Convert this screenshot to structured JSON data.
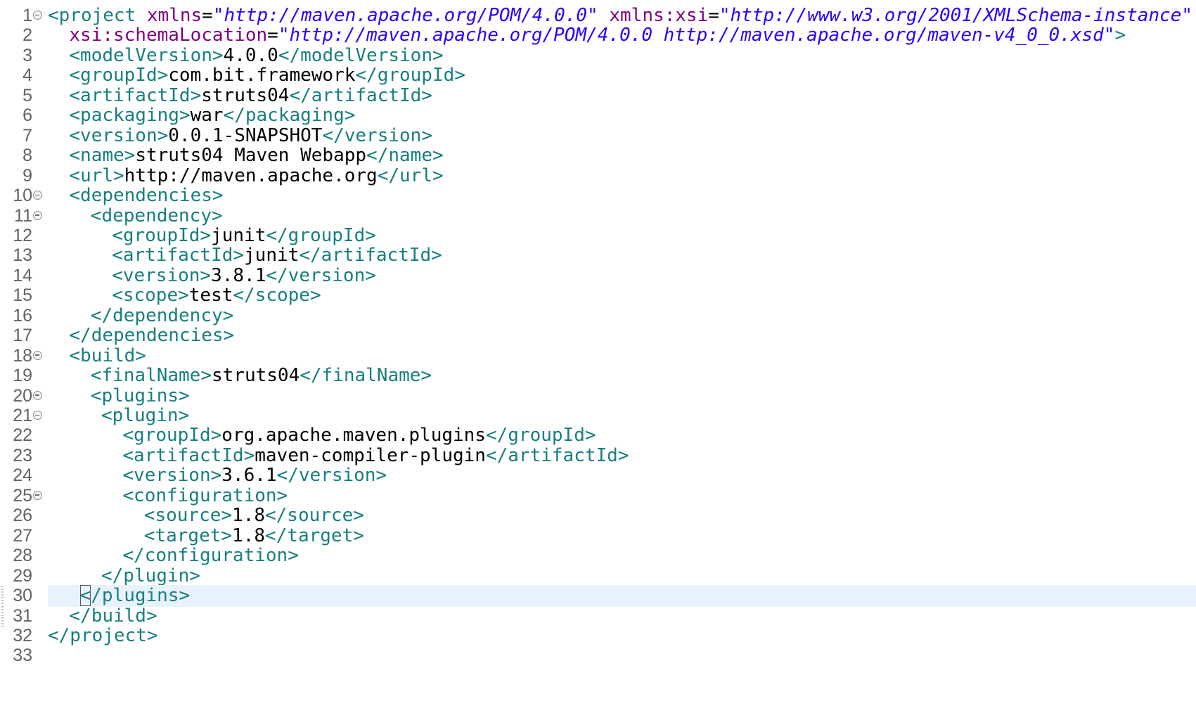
{
  "editor": {
    "current_line": 30,
    "colors": {
      "tag": "#177f80",
      "attribute": "#7f007f",
      "string": "#2a00ff",
      "text": "#000000",
      "line_highlight": "#e8f2fe",
      "line_number": "#5f6368"
    },
    "lines": [
      {
        "n": "1",
        "fold": true,
        "indent": 0,
        "tokens": [
          {
            "t": "tag",
            "v": "<project "
          },
          {
            "t": "attr",
            "v": "xmlns"
          },
          {
            "t": "txt",
            "v": "="
          },
          {
            "t": "str",
            "v": "\"http://maven.apache.org/POM/4.0.0\""
          },
          {
            "t": "txt",
            "v": " "
          },
          {
            "t": "attr",
            "v": "xmlns:xsi"
          },
          {
            "t": "txt",
            "v": "="
          },
          {
            "t": "str",
            "v": "\"http://www.w3.org/2001/XMLSchema-instance\""
          }
        ]
      },
      {
        "n": "2",
        "indent": 2,
        "tokens": [
          {
            "t": "attr",
            "v": "xsi:schemaLocation"
          },
          {
            "t": "txt",
            "v": "="
          },
          {
            "t": "str",
            "v": "\"http://maven.apache.org/POM/4.0.0 http://maven.apache.org/maven-v4_0_0.xsd\""
          },
          {
            "t": "tag",
            "v": ">"
          }
        ]
      },
      {
        "n": "3",
        "indent": 2,
        "tokens": [
          {
            "t": "tag",
            "v": "<modelVersion>"
          },
          {
            "t": "txt",
            "v": "4.0.0"
          },
          {
            "t": "tag",
            "v": "</modelVersion>"
          }
        ]
      },
      {
        "n": "4",
        "indent": 2,
        "tokens": [
          {
            "t": "tag",
            "v": "<groupId>"
          },
          {
            "t": "txt",
            "v": "com.bit.framework"
          },
          {
            "t": "tag",
            "v": "</groupId>"
          }
        ]
      },
      {
        "n": "5",
        "indent": 2,
        "tokens": [
          {
            "t": "tag",
            "v": "<artifactId>"
          },
          {
            "t": "txt",
            "v": "struts04"
          },
          {
            "t": "tag",
            "v": "</artifactId>"
          }
        ]
      },
      {
        "n": "6",
        "indent": 2,
        "tokens": [
          {
            "t": "tag",
            "v": "<packaging>"
          },
          {
            "t": "txt",
            "v": "war"
          },
          {
            "t": "tag",
            "v": "</packaging>"
          }
        ]
      },
      {
        "n": "7",
        "indent": 2,
        "tokens": [
          {
            "t": "tag",
            "v": "<version>"
          },
          {
            "t": "txt",
            "v": "0.0.1-SNAPSHOT"
          },
          {
            "t": "tag",
            "v": "</version>"
          }
        ]
      },
      {
        "n": "8",
        "indent": 2,
        "tokens": [
          {
            "t": "tag",
            "v": "<name>"
          },
          {
            "t": "txt",
            "v": "struts04 Maven Webapp"
          },
          {
            "t": "tag",
            "v": "</name>"
          }
        ]
      },
      {
        "n": "9",
        "indent": 2,
        "tokens": [
          {
            "t": "tag",
            "v": "<url>"
          },
          {
            "t": "txt",
            "v": "http://maven.apache.org"
          },
          {
            "t": "tag",
            "v": "</url>"
          }
        ]
      },
      {
        "n": "10",
        "fold": true,
        "indent": 2,
        "tokens": [
          {
            "t": "tag",
            "v": "<dependencies>"
          }
        ]
      },
      {
        "n": "11",
        "fold": true,
        "indent": 4,
        "tokens": [
          {
            "t": "tag",
            "v": "<dependency>"
          }
        ]
      },
      {
        "n": "12",
        "indent": 6,
        "tokens": [
          {
            "t": "tag",
            "v": "<groupId>"
          },
          {
            "t": "txt",
            "v": "junit"
          },
          {
            "t": "tag",
            "v": "</groupId>"
          }
        ]
      },
      {
        "n": "13",
        "indent": 6,
        "tokens": [
          {
            "t": "tag",
            "v": "<artifactId>"
          },
          {
            "t": "txt",
            "v": "junit"
          },
          {
            "t": "tag",
            "v": "</artifactId>"
          }
        ]
      },
      {
        "n": "14",
        "indent": 6,
        "tokens": [
          {
            "t": "tag",
            "v": "<version>"
          },
          {
            "t": "txt",
            "v": "3.8.1"
          },
          {
            "t": "tag",
            "v": "</version>"
          }
        ]
      },
      {
        "n": "15",
        "indent": 6,
        "tokens": [
          {
            "t": "tag",
            "v": "<scope>"
          },
          {
            "t": "txt",
            "v": "test"
          },
          {
            "t": "tag",
            "v": "</scope>"
          }
        ]
      },
      {
        "n": "16",
        "indent": 4,
        "tokens": [
          {
            "t": "tag",
            "v": "</dependency>"
          }
        ]
      },
      {
        "n": "17",
        "indent": 2,
        "tokens": [
          {
            "t": "tag",
            "v": "</dependencies>"
          }
        ]
      },
      {
        "n": "18",
        "fold": true,
        "indent": 2,
        "tokens": [
          {
            "t": "tag",
            "v": "<build>"
          }
        ]
      },
      {
        "n": "19",
        "indent": 4,
        "tokens": [
          {
            "t": "tag",
            "v": "<finalName>"
          },
          {
            "t": "txt",
            "v": "struts04"
          },
          {
            "t": "tag",
            "v": "</finalName>"
          }
        ]
      },
      {
        "n": "20",
        "fold": true,
        "indent": 4,
        "tokens": [
          {
            "t": "tag",
            "v": "<plugins>"
          }
        ]
      },
      {
        "n": "21",
        "fold": true,
        "indent": 5,
        "tokens": [
          {
            "t": "tag",
            "v": "<plugin>"
          }
        ]
      },
      {
        "n": "22",
        "indent": 7,
        "tokens": [
          {
            "t": "tag",
            "v": "<groupId>"
          },
          {
            "t": "txt",
            "v": "org.apache.maven.plugins"
          },
          {
            "t": "tag",
            "v": "</groupId>"
          }
        ]
      },
      {
        "n": "23",
        "indent": 7,
        "tokens": [
          {
            "t": "tag",
            "v": "<artifactId>"
          },
          {
            "t": "txt",
            "v": "maven-compiler-plugin"
          },
          {
            "t": "tag",
            "v": "</artifactId>"
          }
        ]
      },
      {
        "n": "24",
        "indent": 7,
        "tokens": [
          {
            "t": "tag",
            "v": "<version>"
          },
          {
            "t": "txt",
            "v": "3.6.1"
          },
          {
            "t": "tag",
            "v": "</version>"
          }
        ]
      },
      {
        "n": "25",
        "fold": true,
        "indent": 7,
        "tokens": [
          {
            "t": "tag",
            "v": "<configuration>"
          }
        ]
      },
      {
        "n": "26",
        "indent": 9,
        "tokens": [
          {
            "t": "tag",
            "v": "<source>"
          },
          {
            "t": "txt",
            "v": "1.8"
          },
          {
            "t": "tag",
            "v": "</source>"
          }
        ]
      },
      {
        "n": "27",
        "indent": 9,
        "tokens": [
          {
            "t": "tag",
            "v": "<target>"
          },
          {
            "t": "txt",
            "v": "1.8"
          },
          {
            "t": "tag",
            "v": "</target>"
          }
        ]
      },
      {
        "n": "28",
        "indent": 7,
        "tokens": [
          {
            "t": "tag",
            "v": "</configuration>"
          }
        ]
      },
      {
        "n": "29",
        "indent": 5,
        "tokens": [
          {
            "t": "tag",
            "v": "</plugin>"
          }
        ]
      },
      {
        "n": "30",
        "indent": 3,
        "current": true,
        "tokens": [
          {
            "t": "tag",
            "v": "<",
            "caret": true
          },
          {
            "t": "tag",
            "v": "/plugins>"
          }
        ]
      },
      {
        "n": "31",
        "indent": 2,
        "tokens": [
          {
            "t": "tag",
            "v": "</build>"
          }
        ]
      },
      {
        "n": "32",
        "indent": 0,
        "tokens": [
          {
            "t": "tag",
            "v": "</project>"
          }
        ]
      },
      {
        "n": "33",
        "indent": 0,
        "tokens": []
      }
    ]
  }
}
